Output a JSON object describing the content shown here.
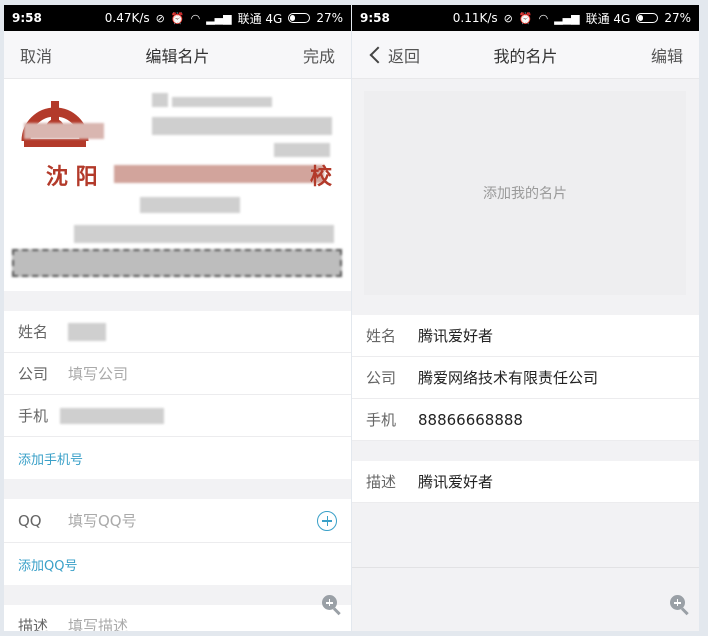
{
  "left": {
    "status": {
      "time": "9:58",
      "speed": "0.47K/s",
      "carrier": "联通 4G",
      "battery": "27%"
    },
    "nav": {
      "cancel": "取消",
      "title": "编辑名片",
      "done": "完成"
    },
    "card_text": {
      "city": "沈 阳",
      "last_char": "校"
    },
    "fields": [
      {
        "label": "姓名",
        "value": ""
      },
      {
        "label": "公司",
        "placeholder": "填写公司"
      },
      {
        "label": "手机",
        "value": ""
      }
    ],
    "add_phone": "添加手机号",
    "qq": {
      "label": "QQ",
      "placeholder": "填写QQ号"
    },
    "add_qq": "添加QQ号",
    "desc": {
      "label": "描述",
      "placeholder": "填写描述"
    }
  },
  "right": {
    "status": {
      "time": "9:58",
      "speed": "0.11K/s",
      "carrier": "联通 4G",
      "battery": "27%"
    },
    "nav": {
      "back": "返回",
      "title": "我的名片",
      "edit": "编辑"
    },
    "add_card": "添加我的名片",
    "fields": [
      {
        "label": "姓名",
        "value": "腾讯爱好者"
      },
      {
        "label": "公司",
        "value": "腾爱网络技术有限责任公司"
      },
      {
        "label": "手机",
        "value": "88866668888"
      }
    ],
    "desc": {
      "label": "描述",
      "value": "腾讯爱好者"
    }
  },
  "icons": {
    "zoom": "zoom-in-icon",
    "add": "plus-circle-icon",
    "back": "chevron-left-icon"
  },
  "colors": {
    "accent": "#3aa0c8",
    "card_red": "#b33a2a"
  }
}
